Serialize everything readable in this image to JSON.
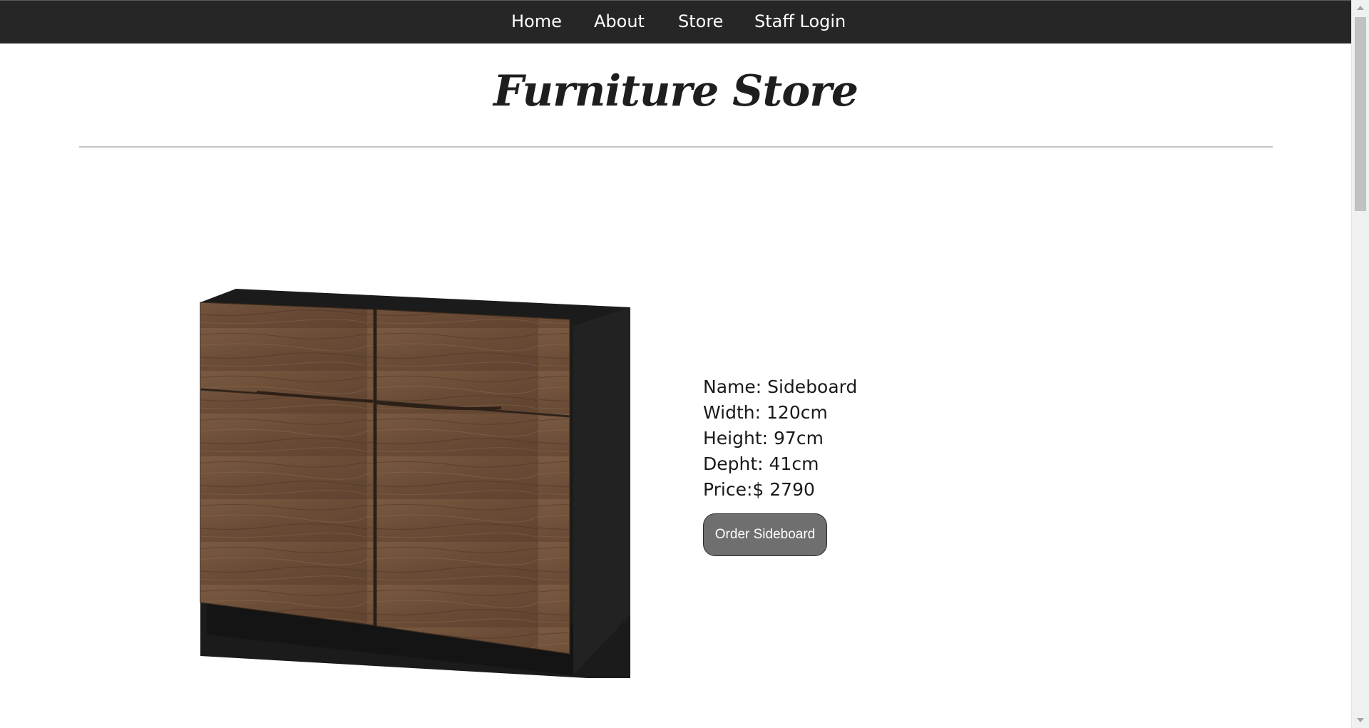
{
  "nav": {
    "items": [
      {
        "label": "Home"
      },
      {
        "label": "About"
      },
      {
        "label": "Store"
      },
      {
        "label": "Staff Login"
      }
    ]
  },
  "header": {
    "title": "Furniture Store"
  },
  "product": {
    "image_alt": "sideboard-image",
    "name_line": "Name: Sideboard",
    "width_line": "Width: 120cm",
    "height_line": "Height: 97cm",
    "depth_line": "Depht: 41cm",
    "price_line": "Price:$ 2790",
    "order_label": "Order Sideboard"
  },
  "colors": {
    "navbar_bg": "#262626",
    "button_bg": "#6f6f6f",
    "title": "#1e1e1e"
  },
  "icons": {
    "scroll_up": "triangle-up-icon",
    "scroll_down": "triangle-down-icon"
  }
}
